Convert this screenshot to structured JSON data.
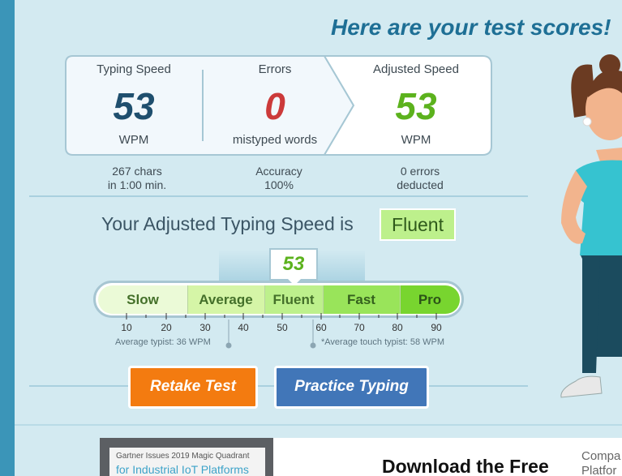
{
  "header": {
    "title": "Here are your test scores!"
  },
  "scores": [
    {
      "label": "Typing Speed",
      "value": "53",
      "unit": "WPM"
    },
    {
      "label": "Errors",
      "value": "0",
      "unit": "mistyped words"
    },
    {
      "label": "Adjusted Speed",
      "value": "53",
      "unit": "WPM"
    }
  ],
  "details": {
    "chars": "267 chars",
    "time": "in 1:00 min.",
    "accuracy_label": "Accuracy",
    "accuracy_value": "100%",
    "errors_deducted_1": "0 errors",
    "errors_deducted_2": "deducted"
  },
  "adjusted": {
    "text": "Your Adjusted Typing Speed is",
    "level": "Fluent"
  },
  "scale": {
    "current_wpm": "53",
    "segments": [
      "Slow",
      "Average",
      "Fluent",
      "Fast",
      "Pro"
    ],
    "ticks": [
      "10",
      "20",
      "30",
      "40",
      "50",
      "60",
      "70",
      "80",
      "90"
    ],
    "avg_typist_note": "Average typist: 36 WPM",
    "avg_touch_note": "*Average touch typist: 58 WPM"
  },
  "buttons": {
    "retake": "Retake Test",
    "practice": "Practice Typing"
  },
  "ad": {
    "img_line1": "Gartner Issues 2019 Magic Quadrant",
    "img_line2": "for Industrial IoT Platforms",
    "headline": "Download the Free",
    "side_line1": "Compa",
    "side_line2": "Platfor"
  },
  "colors": {
    "title": "#1e6f95",
    "typing_speed": "#1f4f6e",
    "errors": "#cc3a3a",
    "adjusted_speed": "#5cb21d",
    "retake_button": "#f37b10",
    "practice_button": "#4176b8"
  }
}
